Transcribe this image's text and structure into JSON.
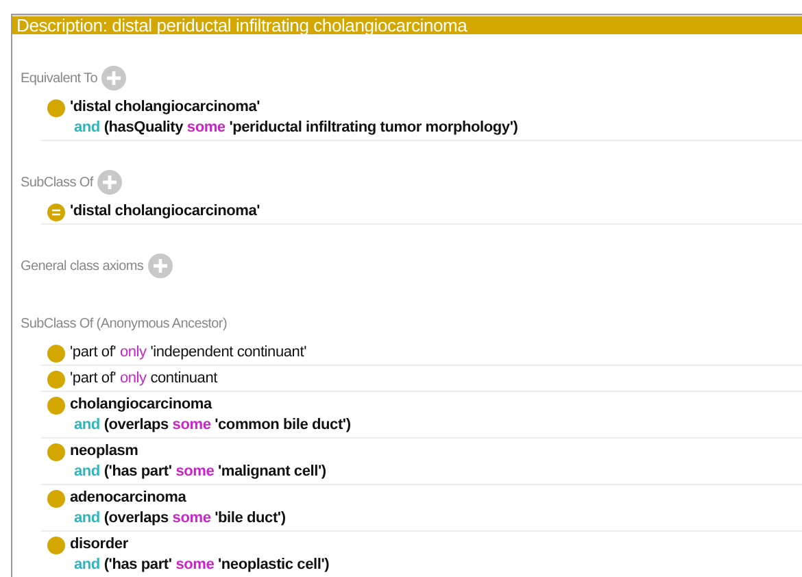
{
  "title": "Description: distal periductal infiltrating cholangiocarcinoma",
  "sections": [
    {
      "label": "Equivalent To",
      "add_button": true,
      "rows": [
        {
          "kind": "class",
          "bold": true,
          "lines": [
            [
              {
                "kind": "plain",
                "text": "'distal cholangiocarcinoma'"
              }
            ],
            [
              {
                "kind": "and",
                "text": "and"
              },
              {
                "kind": "plain",
                "text": "(hasQuality"
              },
              {
                "kind": "quantifier",
                "text": "some"
              },
              {
                "kind": "plain",
                "text": "'periductal infiltrating tumor morphology')"
              }
            ]
          ]
        }
      ]
    },
    {
      "label": "SubClass Of",
      "add_button": true,
      "rows": [
        {
          "kind": "equivalent",
          "bold": true,
          "lines": [
            [
              {
                "kind": "plain",
                "text": "'distal cholangiocarcinoma'"
              }
            ]
          ]
        }
      ]
    },
    {
      "label": "General class axioms",
      "add_button": true
    },
    {
      "label": "SubClass Of (Anonymous Ancestor)",
      "add_button": false,
      "rows": [
        {
          "kind": "class",
          "bold": false,
          "lines": [
            [
              {
                "kind": "plain",
                "text": "'part of'"
              },
              {
                "kind": "quantifier",
                "text": "only"
              },
              {
                "kind": "plain",
                "text": "'independent continuant'"
              }
            ]
          ]
        },
        {
          "kind": "class",
          "bold": false,
          "lines": [
            [
              {
                "kind": "plain",
                "text": "'part of'"
              },
              {
                "kind": "quantifier",
                "text": "only"
              },
              {
                "kind": "plain",
                "text": "continuant"
              }
            ]
          ]
        },
        {
          "kind": "class",
          "bold": true,
          "lines": [
            [
              {
                "kind": "plain",
                "text": "cholangiocarcinoma"
              }
            ],
            [
              {
                "kind": "and",
                "text": "and"
              },
              {
                "kind": "plain",
                "text": "(overlaps"
              },
              {
                "kind": "quantifier",
                "text": "some"
              },
              {
                "kind": "plain",
                "text": "'common bile duct')"
              }
            ]
          ]
        },
        {
          "kind": "class",
          "bold": true,
          "lines": [
            [
              {
                "kind": "plain",
                "text": "neoplasm"
              }
            ],
            [
              {
                "kind": "and",
                "text": "and"
              },
              {
                "kind": "plain",
                "text": "('has part'"
              },
              {
                "kind": "quantifier",
                "text": "some"
              },
              {
                "kind": "plain",
                "text": "'malignant cell')"
              }
            ]
          ]
        },
        {
          "kind": "class",
          "bold": true,
          "lines": [
            [
              {
                "kind": "plain",
                "text": "adenocarcinoma"
              }
            ],
            [
              {
                "kind": "and",
                "text": "and"
              },
              {
                "kind": "plain",
                "text": "(overlaps"
              },
              {
                "kind": "quantifier",
                "text": "some"
              },
              {
                "kind": "plain",
                "text": "'bile duct')"
              }
            ]
          ]
        },
        {
          "kind": "class",
          "bold": true,
          "lines": [
            [
              {
                "kind": "plain",
                "text": "disorder"
              }
            ],
            [
              {
                "kind": "and",
                "text": "and"
              },
              {
                "kind": "plain",
                "text": "('has part'"
              },
              {
                "kind": "quantifier",
                "text": "some"
              },
              {
                "kind": "plain",
                "text": "'neoplastic cell')"
              }
            ]
          ]
        }
      ]
    }
  ]
}
